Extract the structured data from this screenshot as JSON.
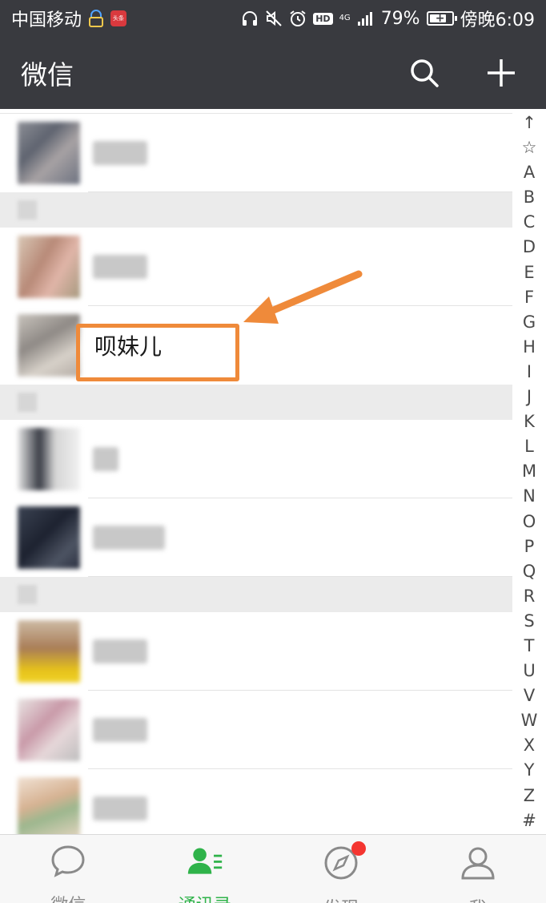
{
  "status_bar": {
    "carrier": "中国移动",
    "app_badge": "头条",
    "network": "4G",
    "battery": "79%",
    "battery_level": 0.79,
    "time": "傍晚6:09",
    "hd": "HD"
  },
  "header": {
    "title": "微信"
  },
  "contacts": {
    "highlighted_name": "呗妹儿"
  },
  "index_bar": [
    "↑",
    "☆",
    "A",
    "B",
    "C",
    "D",
    "E",
    "F",
    "G",
    "H",
    "I",
    "J",
    "K",
    "L",
    "M",
    "N",
    "O",
    "P",
    "Q",
    "R",
    "S",
    "T",
    "U",
    "V",
    "W",
    "X",
    "Y",
    "Z",
    "#"
  ],
  "tabs": [
    {
      "label": "微信",
      "icon": "chat-bubble-icon",
      "active": false
    },
    {
      "label": "通讯录",
      "icon": "contacts-icon",
      "active": true
    },
    {
      "label": "发现",
      "icon": "compass-icon",
      "active": false,
      "badge_dot": true
    },
    {
      "label": "我",
      "icon": "person-icon",
      "active": false
    }
  ],
  "colors": {
    "header_bg": "#393a3f",
    "accent_green": "#2fb34a",
    "annotation_orange": "#ef8a3a",
    "badge_red": "#f43530"
  }
}
